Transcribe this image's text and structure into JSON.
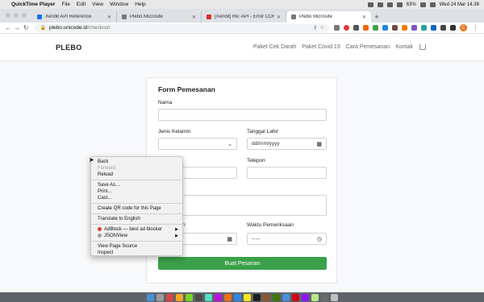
{
  "menubar": {
    "apple": "",
    "app": "QuickTime Player",
    "items": [
      "File",
      "Edit",
      "View",
      "Window",
      "Help"
    ],
    "battery": "63%",
    "clock": "Wed 24 Mar  14.38"
  },
  "tabs": [
    {
      "title": "Xendit API Reference",
      "color": "#1a73e8"
    },
    {
      "title": "Plebo Microsite",
      "color": "#777777"
    },
    {
      "title": "[Xendit] Re: API - Error CORS",
      "color": "#d93025"
    },
    {
      "title": "Plebo Microsite",
      "color": "#777777"
    }
  ],
  "newtab": "+",
  "address": {
    "host": "plebo.unicode.id",
    "path": "/checkout"
  },
  "site": {
    "brand": "PLEBO",
    "links": [
      "Paket Cek Darah",
      "Paket Covid 19",
      "Cara Pemesanan",
      "Kontak"
    ]
  },
  "form": {
    "title": "Form Pemesanan",
    "nama_label": "Nama",
    "jenis_label": "Jenis Kelamin",
    "tanggal_label": "Tanggal Lahir",
    "tanggal_placeholder": "dd/mm/yyyy",
    "telepon_label": "Telepon",
    "tgl_pemeriksaan_label": "emeriksaan",
    "tgl_pemeriksaan_value": "yyyy",
    "waktu_label": "Waktu Pemeriksaan",
    "waktu_placeholder": "--.--",
    "submit": "Buat Pesanan"
  },
  "context_menu": {
    "back": "Back",
    "forward": "Forward",
    "reload": "Reload",
    "save_as": "Save As...",
    "print": "Print...",
    "cast": "Cast...",
    "qr": "Create QR code for this Page",
    "translate": "Translate to English",
    "adblock": "AdBlock — best ad blocker",
    "jsonview": "JSONView",
    "view_source": "View Page Source",
    "inspect": "Inspect"
  }
}
